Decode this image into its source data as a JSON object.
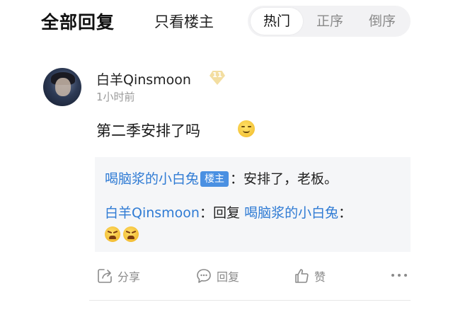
{
  "header": {
    "title": "全部回复",
    "only_op": "只看楼主",
    "sort_tabs": [
      {
        "label": "热门",
        "active": true
      },
      {
        "label": "正序",
        "active": false
      },
      {
        "label": "倒序",
        "active": false
      }
    ]
  },
  "comment": {
    "username": "白羊Qinsmoon",
    "level": "11",
    "time": "1小时前",
    "text": "第二季安排了吗",
    "emoji": "smiling-face"
  },
  "replies": [
    {
      "author": "喝脑浆的小白兔",
      "tag": "楼主",
      "sep": "：",
      "text": "安排了，老板。"
    },
    {
      "author": "白羊Qinsmoon",
      "sep": "：",
      "reply_word": "回复",
      "target": "喝脑浆的小白兔",
      "sep2": "：",
      "emojis": [
        "angry-face",
        "angry-face"
      ]
    }
  ],
  "actions": {
    "share": "分享",
    "reply": "回复",
    "like": "赞"
  },
  "colors": {
    "link": "#2f7bd4",
    "op_tag": "#4a90e2",
    "reply_bg": "#f5f6f8"
  }
}
